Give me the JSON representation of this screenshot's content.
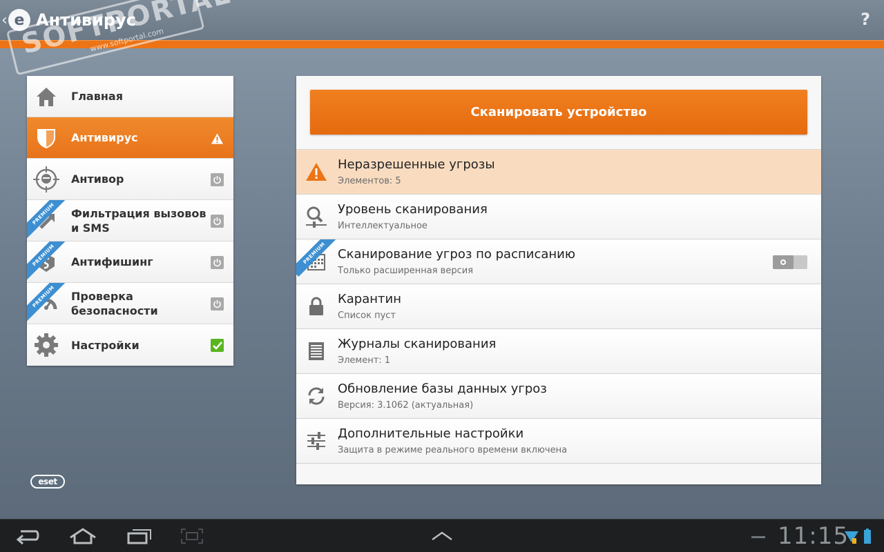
{
  "app": {
    "title": "Антивирус",
    "logo_letter": "e",
    "help_label": "?"
  },
  "watermark": {
    "text": "SOFTPORTAL",
    "url": "www.softportal.com",
    "tm": "™"
  },
  "sidebar": {
    "items": [
      {
        "label": "Главная",
        "icon": "home-icon",
        "premium": false,
        "status": null,
        "active": false
      },
      {
        "label": "Антивирус",
        "icon": "shield-icon",
        "premium": false,
        "status": "warning",
        "active": true
      },
      {
        "label": "Антивор",
        "icon": "target-icon",
        "premium": false,
        "status": "off",
        "active": false
      },
      {
        "label": "Фильтрация вызовов и SMS",
        "icon": "call-filter-icon",
        "premium": true,
        "status": "off",
        "active": false
      },
      {
        "label": "Антифишинг",
        "icon": "antiphishing-icon",
        "premium": true,
        "status": "off",
        "active": false
      },
      {
        "label": "Проверка безопасности",
        "icon": "gauge-icon",
        "premium": true,
        "status": "off",
        "active": false
      },
      {
        "label": "Настройки",
        "icon": "gear-icon",
        "premium": false,
        "status": "ok",
        "active": false
      }
    ],
    "premium_label": "PREMIUM"
  },
  "brand": {
    "logo_text": "eset"
  },
  "main": {
    "scan_button": "Сканировать устройство",
    "rows": [
      {
        "title": "Неразрешенные угрозы",
        "subtitle": "Элементов: 5",
        "icon": "warning-icon",
        "alert": true
      },
      {
        "title": "Уровень сканирования",
        "subtitle": "Интеллектуальное",
        "icon": "scan-level-icon"
      },
      {
        "title": "Сканирование угроз по расписанию",
        "subtitle": "Только расширенная версия",
        "icon": "calendar-icon",
        "premium": true,
        "toggle": "off"
      },
      {
        "title": "Карантин",
        "subtitle": "Список пуст",
        "icon": "lock-icon"
      },
      {
        "title": "Журналы сканирования",
        "subtitle": "Элемент: 1",
        "icon": "log-icon"
      },
      {
        "title": "Обновление базы данных угроз",
        "subtitle": "Версия: 3.1062 (актуальная)",
        "icon": "refresh-icon"
      },
      {
        "title": "Дополнительные настройки",
        "subtitle": "Защита в режиме реального времени включена",
        "icon": "sliders-icon"
      }
    ]
  },
  "system_bar": {
    "time": "11:15"
  },
  "colors": {
    "accent": "#ec7416",
    "alert_row": "#f9dcc0",
    "premium": "#3d8fd1",
    "status_ok": "#59b51f",
    "status_off": "#a9a9a9"
  }
}
